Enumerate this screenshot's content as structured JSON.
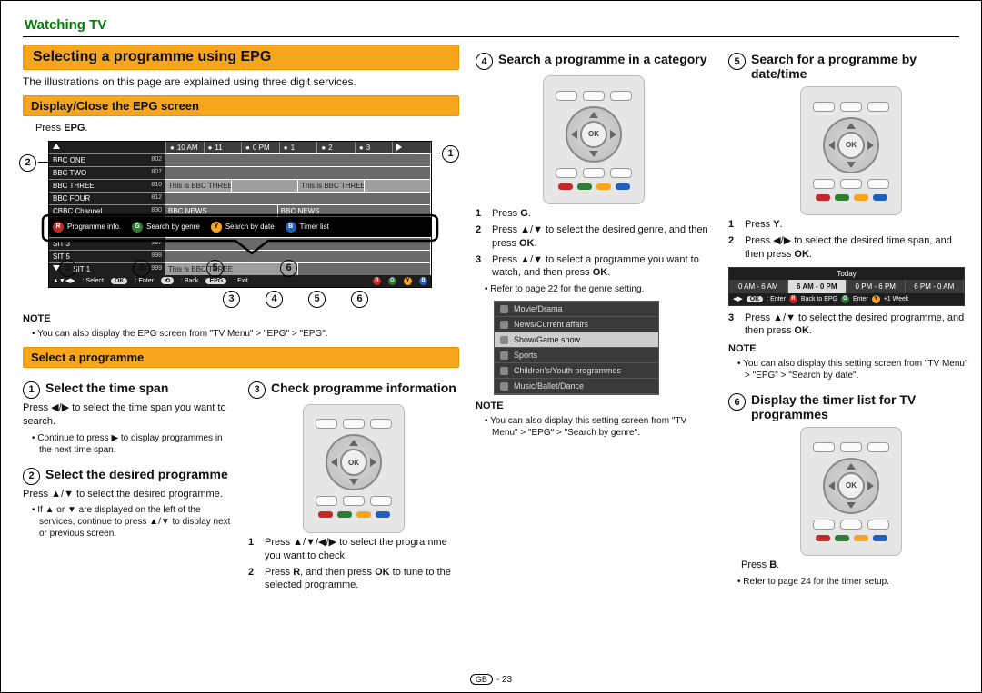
{
  "breadcrumb": "Watching TV",
  "banner_main": "Selecting a programme using EPG",
  "intro": "The illustrations on this page are explained using three digit services.",
  "subbanner_display": "Display/Close the EPG screen",
  "press_epg_pre": "Press ",
  "press_epg_bold": "EPG",
  "press_epg_post": ".",
  "epg": {
    "time": [
      "10 AM",
      "11",
      "0 PM",
      "1",
      "2",
      "3"
    ],
    "services": [
      {
        "name": "BBC ONE",
        "num": "802"
      },
      {
        "name": "BBC TWO",
        "num": "807"
      },
      {
        "name": "BBC THREE",
        "num": "810"
      },
      {
        "name": "BBC FOUR",
        "num": "812"
      },
      {
        "name": "CBBC Channel",
        "num": "830"
      }
    ],
    "svc_below": [
      {
        "name": "SIT 3",
        "num": "997"
      },
      {
        "name": "SIT 5",
        "num": "998"
      },
      {
        "name": "SIT 1",
        "num": "999"
      }
    ],
    "prog_a": "This is BBC THREE",
    "prog_b": "This is BBC THREE",
    "prog_news": "BBC NEWS",
    "colorbar": {
      "r": "Programme info.",
      "g": "Search by genre",
      "y": "Search by date",
      "b": "Timer list"
    },
    "footer": {
      "select": ": Select",
      "ok_lbl": "OK",
      "enter": ": Enter",
      "back": ": Back",
      "epg": ": Exit",
      "letters": [
        "R",
        "G",
        "Y",
        "B"
      ]
    }
  },
  "callouts": {
    "c1": "1",
    "c2": "2",
    "c3": "3",
    "c4": "4",
    "c5": "5",
    "c6": "6"
  },
  "note_label": "NOTE",
  "note_epg": "You can also display the EPG screen from \"TV Menu\" > \"EPG\" > \"EPG\".",
  "subbanner_select": "Select a programme",
  "step1": {
    "title": "Select the time span",
    "body": "Press ◀/▶ to select the time span you want to search.",
    "bul": "Continue to press ▶ to display programmes in the next time span."
  },
  "step2": {
    "title": "Select the desired programme",
    "body": "Press ▲/▼ to select the desired programme.",
    "bul": "If ▲ or ▼ are displayed on the left of the services, continue to press ▲/▼ to display next or previous screen."
  },
  "step3": {
    "title": "Check programme information",
    "li1": "Press ▲/▼/◀/▶ to select the programme you want to check.",
    "li2a": "Press ",
    "li2b": "R",
    "li2c": ", and then press ",
    "li2d": "OK",
    "li2e": " to tune to the selected programme."
  },
  "step4": {
    "title": "Search a programme in a category",
    "li1a": "Press ",
    "li1b": "G",
    "li1c": ".",
    "li2a": "Press ▲/▼ to select the desired genre, and then press ",
    "li2b": "OK",
    "li2c": ".",
    "li3a": "Press ▲/▼ to select a programme you want to watch, and then press ",
    "li3b": "OK",
    "li3c": ".",
    "bul": "Refer to page 22 for the genre setting.",
    "note": "You can also display this setting screen from \"TV Menu\" > \"EPG\" > \"Search by genre\"."
  },
  "genres": [
    "Movie/Drama",
    "News/Current affairs",
    "Show/Game show",
    "Sports",
    "Children's/Youth programmes",
    "Music/Ballet/Dance"
  ],
  "step5": {
    "title": "Search for a programme by date/time",
    "li1a": "Press ",
    "li1b": "Y",
    "li1c": ".",
    "li2a": "Press ◀/▶ to select the desired time span, and then press ",
    "li2b": "OK",
    "li2c": ".",
    "li3a": "Press ▲/▼ to select the desired programme, and then press ",
    "li3b": "OK",
    "li3c": ".",
    "note": "You can also display this setting screen from \"TV Menu\" > \"EPG\" > \"Search by date\"."
  },
  "timestrip": {
    "hdr": "Today",
    "segs": [
      "0 AM - 6 AM",
      "6 AM - 0 PM",
      "0 PM - 6 PM",
      "6 PM - 0 AM"
    ],
    "footer": {
      "ok": "OK",
      "enter": ": Enter",
      "r": "R",
      "back": "Back to EPG",
      "g": "G",
      "gact": "Enter",
      "y": "Y",
      "yact": "+1 Week"
    }
  },
  "step6": {
    "title": "Display the timer list for TV programmes",
    "press_pre": "Press ",
    "press_b": "B",
    "press_post": ".",
    "bul": "Refer to page 24 for the timer setup."
  },
  "pagefoot_gb": "GB",
  "pagefoot_num": "- 23"
}
